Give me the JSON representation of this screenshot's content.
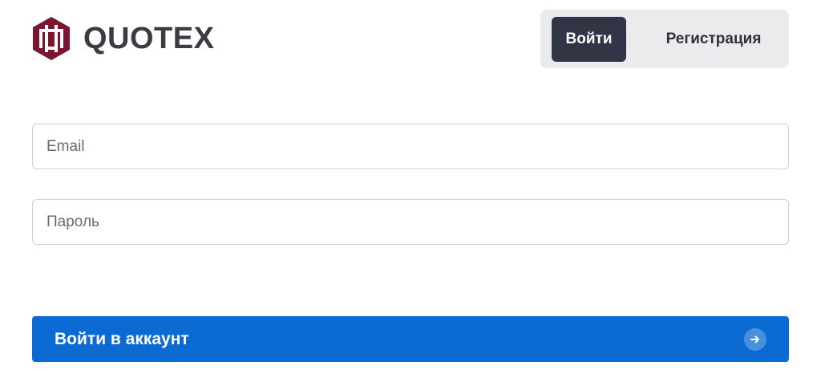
{
  "brand": {
    "name": "QUOTEX",
    "logo_color": "#7b1530"
  },
  "auth_tabs": {
    "login_label": "Войти",
    "register_label": "Регистрация"
  },
  "form": {
    "email_placeholder": "Email",
    "password_placeholder": "Пароль",
    "submit_label": "Войти в аккаунт",
    "submit_icon": "arrow-right-icon"
  },
  "colors": {
    "accent": "#0b6bd3",
    "active_tab": "#323546"
  }
}
